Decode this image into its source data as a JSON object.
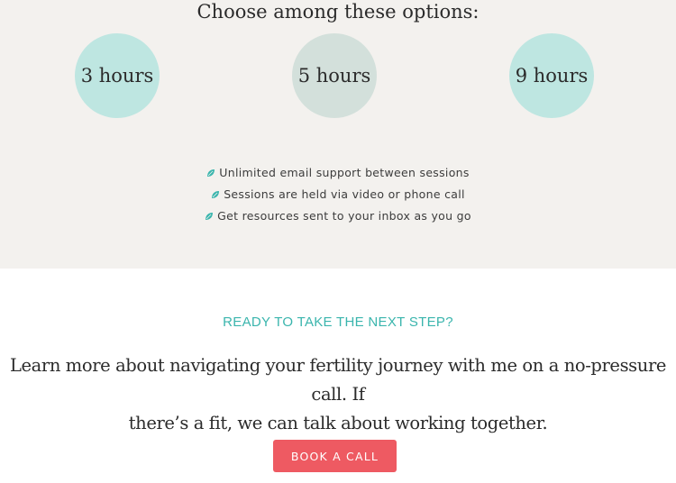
{
  "options_section": {
    "heading": "Choose among these options:",
    "options": [
      {
        "label": "3 hours"
      },
      {
        "label": "5 hours"
      },
      {
        "label": "9 hours"
      }
    ],
    "features": [
      {
        "text": "Unlimited email support between sessions",
        "icon": "leaf-icon"
      },
      {
        "text": "Sessions are held via video or phone call",
        "icon": "leaf-icon"
      },
      {
        "text": "Get resources sent to your inbox as you go",
        "icon": "leaf-icon"
      }
    ]
  },
  "cta_section": {
    "kicker": "READY TO TAKE THE NEXT STEP?",
    "text_line1": "Learn more about navigating your fertility journey with me on a no-pressure call. If",
    "text_line2": "there’s a fit, we can talk about working together.",
    "button_label": "BOOK A CALL"
  },
  "colors": {
    "background_light": "#f3f1ee",
    "circle_teal": "#bee6e1",
    "circle_sage": "#d3e0db",
    "accent_teal": "#3ab5ad",
    "button_coral": "#ee5a62",
    "leaf_icon": "#3ab5ad"
  }
}
